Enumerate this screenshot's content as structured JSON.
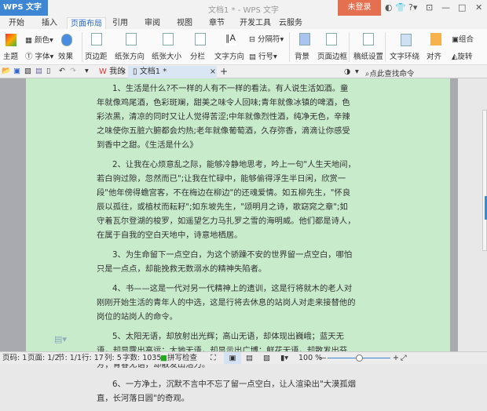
{
  "titlebar": {
    "app_name": "WPS 文字",
    "doc_title": "文档1 * - WPS 文字",
    "login": "未登录"
  },
  "tabs": [
    "开始",
    "插入",
    "页面布局",
    "引用",
    "审阅",
    "视图",
    "章节",
    "开发工具",
    "云服务"
  ],
  "active_tab": "页面布局",
  "ribbon": {
    "theme": "主题",
    "color": "颜色",
    "font": "字体",
    "effect": "效果",
    "margins": "页边距",
    "orientation": "纸张方向",
    "size": "纸张大小",
    "columns": "分栏",
    "text_direction": "文字方向",
    "breaks": "分隔符",
    "line_numbers": "行号",
    "background": "背景",
    "page_border": "页面边框",
    "draft_settings": "稿纸设置",
    "text_wrap": "文字环绕",
    "align": "对齐",
    "group": "组合",
    "rotate": "旋转"
  },
  "doc_tabs": [
    {
      "label": "我的WPS"
    },
    {
      "label": "文档1 *"
    }
  ],
  "search_command": "点此查找命令",
  "paragraphs": [
    "1、生活是什么?不一样的人有不一样的看法。有人说生活如酒。童年就像鸡尾酒，色彩斑斓，甜美之味令人回味;青年就像冰镇的啤酒，色彩浓黑，清凉的同时又让人觉得苦涩;中年就像烈性酒，纯净无色，辛辣之味使你五脏六腑都会灼热;老年就像葡萄酒，久存弥香，滴滴让你感受到香中之甜。《生活是什么》",
    "2、让我在心烦意乱之际，能够冷静地思考，吟上一句\"人生天地间，若白驹过隙，忽然而已\";让我在忙碌中，能够偷得浮生半日闲，欣赏一段\"他年傍得蟾宫客，不在梅边在柳边\"的还魂爱情。如五柳先生，\"怀良辰以孤往，或植杖而耘耔\";如东坡先生，\"颂明月之诗，歌窈窕之章\";如守着瓦尔登湖的梭罗，如遥望乞力马扎罗之雪的海明威。他们都是诗人，在属于自我的空白天地中，诗意地栖居。",
    "3、为生命留下一点空白，为这个骄躁不安的世界留一点空白，哪怕只是一点点，却能挽救无数溺水的精神失陷者。",
    "4、书——这是一代对另一代精神上的遗训，这是行将就木的老人对刚刚开始生活的青年人的中选，这是行将去休息的站岗人对走来接替他的岗位的站岗人的命令。",
    "5、太阳无语，却放射出光辉；高山无语，却体现出巍峨；蓝天无语，却显露出高远；大地无语，却显示出广博；鲜花无语，却散发出芬芳；青春无语，却散发出活力。",
    "6、一方净土，沉默不言中不忘了留一点空白，让人渲染出\"大漠孤烟直，长河落日圆\"的奇观。"
  ],
  "status": {
    "page_num": "页码: 1",
    "page": "页面: 1/2",
    "section": "节: 1/1",
    "line": "行: 17",
    "column": "列: 5",
    "word_count": "字数: 1035",
    "spell_check": "拼写检查",
    "zoom": "100 %"
  },
  "zoom_percent": 100,
  "colors": {
    "accent": "#3c86d4",
    "login": "#e5704f",
    "page_bg": "#c7ebcb"
  }
}
